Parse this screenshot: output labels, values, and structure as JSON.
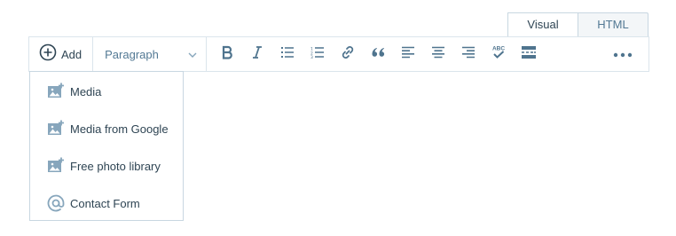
{
  "tabs": {
    "visual": "Visual",
    "html": "HTML"
  },
  "toolbar": {
    "add_label": "Add",
    "format_value": "Paragraph",
    "tools": [
      {
        "icon": "bold-icon"
      },
      {
        "icon": "italic-icon"
      },
      {
        "icon": "bulleted-list-icon"
      },
      {
        "icon": "numbered-list-icon"
      },
      {
        "icon": "link-icon"
      },
      {
        "icon": "blockquote-icon"
      },
      {
        "icon": "align-left-icon"
      },
      {
        "icon": "align-center-icon"
      },
      {
        "icon": "align-right-icon"
      },
      {
        "icon": "spellcheck-icon",
        "text": "ABC"
      },
      {
        "icon": "read-more-icon"
      }
    ],
    "more_icon": "more-icon"
  },
  "dropdown": {
    "items": [
      {
        "label": "Media",
        "icon": "image-add-icon"
      },
      {
        "label": "Media from Google",
        "icon": "image-add-icon"
      },
      {
        "label": "Free photo library",
        "icon": "image-add-icon"
      },
      {
        "label": "Contact Form",
        "icon": "at-icon"
      }
    ]
  },
  "colors": {
    "icon": "#4f748e",
    "border": "#dbe5ec",
    "text": "#2e4453"
  }
}
